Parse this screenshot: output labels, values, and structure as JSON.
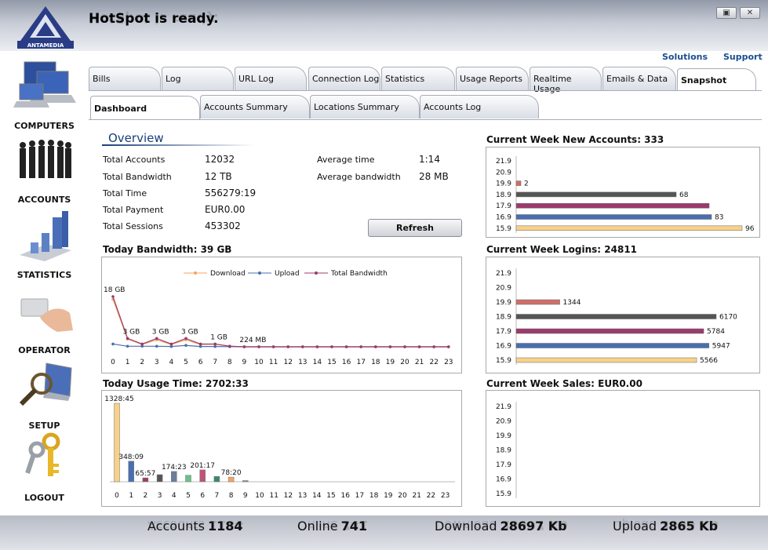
{
  "app": {
    "title": "HotSpot is ready.",
    "logo_text": "ANTAMEDIA"
  },
  "window_buttons": [
    "restore",
    "close"
  ],
  "sidebar": {
    "items": [
      {
        "label": "COMPUTERS",
        "icon": "computers-icon"
      },
      {
        "label": "ACCOUNTS",
        "icon": "accounts-icon"
      },
      {
        "label": "STATISTICS",
        "icon": "statistics-icon"
      },
      {
        "label": "OPERATOR",
        "icon": "operator-icon"
      },
      {
        "label": "SETUP",
        "icon": "setup-icon"
      },
      {
        "label": "LOGOUT",
        "icon": "logout-icon"
      }
    ]
  },
  "links": {
    "solutions": "Solutions",
    "support": "Support"
  },
  "tabs_row1": [
    "Bills",
    "Log",
    "URL Log",
    "Connection Log",
    "Statistics",
    "Usage Reports",
    "Realtime Usage",
    "Emails & Data",
    "Snapshot"
  ],
  "tabs_row2": [
    "Dashboard",
    "Accounts Summary",
    "Locations Summary",
    "Accounts Log"
  ],
  "active_tab1": "Snapshot",
  "active_tab2": "Dashboard",
  "overview": {
    "title": "Overview",
    "stats": [
      {
        "label": "Total Accounts",
        "value": "12032"
      },
      {
        "label": "Total Bandwidth",
        "value": "12 TB"
      },
      {
        "label": "Total Time",
        "value": "556279:19"
      },
      {
        "label": "Total Payment",
        "value": "EUR0.00"
      },
      {
        "label": "Total Sessions",
        "value": "453302"
      }
    ],
    "stats2": [
      {
        "label": "Average time",
        "value": "1:14"
      },
      {
        "label": "Average bandwidth",
        "value": "28 MB"
      }
    ],
    "refresh_label": "Refresh"
  },
  "bottom": {
    "accounts_label": "Accounts",
    "accounts_value": "1184",
    "online_label": "Online",
    "online_value": "741",
    "download_label": "Download",
    "download_value": "28697 Kb",
    "upload_label": "Upload",
    "upload_value": "2865 Kb"
  },
  "chart_data": [
    {
      "type": "line",
      "title": "Today Bandwidth: 39 GB",
      "x": [
        0,
        1,
        2,
        3,
        4,
        5,
        6,
        7,
        8,
        9,
        10,
        11,
        12,
        13,
        14,
        15,
        16,
        17,
        18,
        19,
        20,
        21,
        22,
        23
      ],
      "series": [
        {
          "name": "Download",
          "color": "#f4a460",
          "values": [
            17,
            2.8,
            0.8,
            2.5,
            0.8,
            2.5,
            0.8,
            0.9,
            0.2,
            0,
            0,
            0,
            0,
            0,
            0,
            0,
            0,
            0,
            0,
            0,
            0,
            0,
            0,
            0
          ]
        },
        {
          "name": "Upload",
          "color": "#4a6fb0",
          "values": [
            1,
            0.2,
            0.2,
            0.2,
            0.1,
            0.5,
            0.1,
            0.1,
            0.05,
            0,
            0,
            0,
            0,
            0,
            0,
            0,
            0,
            0,
            0,
            0,
            0,
            0,
            0,
            0
          ]
        },
        {
          "name": "Total Bandwidth",
          "color": "#9b3b6b",
          "values": [
            18,
            3,
            1,
            3,
            1,
            3,
            1,
            1,
            0.224,
            0,
            0,
            0,
            0,
            0,
            0,
            0,
            0,
            0,
            0,
            0,
            0,
            0,
            0,
            0
          ]
        }
      ],
      "labels": [
        {
          "x": 0,
          "text": "18 GB"
        },
        {
          "x": 1,
          "text": "3 GB"
        },
        {
          "x": 3,
          "text": "3 GB"
        },
        {
          "x": 5,
          "text": "3 GB"
        },
        {
          "x": 7,
          "text": "1 GB"
        },
        {
          "x": 9,
          "text": "224 MB"
        }
      ],
      "ylim": [
        0,
        18
      ]
    },
    {
      "type": "bar",
      "title": "Today Usage Time: 2702:33",
      "categories": [
        "0",
        "1",
        "2",
        "3",
        "4",
        "5",
        "6",
        "7",
        "8",
        "9",
        "10",
        "11",
        "12",
        "13",
        "14",
        "15",
        "16",
        "17",
        "18",
        "19",
        "20",
        "21",
        "22",
        "23"
      ],
      "values": [
        1328.75,
        348.15,
        65.95,
        120,
        174.38,
        110,
        201.28,
        90,
        78.33,
        20,
        0,
        0,
        0,
        0,
        0,
        0,
        0,
        0,
        0,
        0,
        0,
        0,
        0,
        0
      ],
      "bar_labels": [
        "1328:45",
        "348:09",
        "65:57",
        "",
        "174:23",
        "",
        "201:17",
        "",
        "78:20",
        "",
        "",
        "",
        "",
        "",
        "",
        "",
        "",
        "",
        "",
        "",
        "",
        "",
        "",
        ""
      ],
      "colors": [
        "#f7d08a",
        "#4a6fb0",
        "#9b3b6b",
        "#555555",
        "#6b7f9b",
        "#6ac08a",
        "#c2527a",
        "#3a8a6a",
        "#f4a460",
        "#888888"
      ],
      "ylim": [
        0,
        1328.75
      ]
    },
    {
      "type": "bar",
      "orientation": "horizontal",
      "title": "Current Week New Accounts: 333",
      "categories": [
        "21.9",
        "20.9",
        "19.9",
        "18.9",
        "17.9",
        "16.9",
        "15.9"
      ],
      "values": [
        0,
        0,
        2,
        68,
        82,
        83,
        96
      ],
      "bar_labels": [
        "",
        "",
        "2",
        "68",
        "",
        "83",
        "96"
      ],
      "colors": [
        "#888888",
        "#888888",
        "#cf6f6a",
        "#555555",
        "#9b3b6b",
        "#4a6fb0",
        "#f7d08a"
      ],
      "xlim": [
        0,
        96
      ]
    },
    {
      "type": "bar",
      "orientation": "horizontal",
      "title": "Current Week Logins: 24811",
      "categories": [
        "21.9",
        "20.9",
        "19.9",
        "18.9",
        "17.9",
        "16.9",
        "15.9"
      ],
      "values": [
        0,
        0,
        1344,
        6170,
        5784,
        5947,
        5566
      ],
      "bar_labels": [
        "",
        "",
        "1344",
        "6170",
        "5784",
        "5947",
        "5566"
      ],
      "colors": [
        "#888888",
        "#888888",
        "#cf6f6a",
        "#555555",
        "#9b3b6b",
        "#4a6fb0",
        "#f7d08a"
      ],
      "xlim": [
        0,
        6170
      ]
    },
    {
      "type": "bar",
      "orientation": "horizontal",
      "title": "Current Week Sales: EUR0.00",
      "categories": [
        "21.9",
        "20.9",
        "19.9",
        "18.9",
        "17.9",
        "16.9",
        "15.9"
      ],
      "values": [
        0,
        0,
        0,
        0,
        0,
        0,
        0
      ],
      "bar_labels": [
        "",
        "",
        "",
        "",
        "",
        "",
        ""
      ],
      "colors": [
        "#888888",
        "#888888",
        "#888888",
        "#888888",
        "#888888",
        "#888888",
        "#888888"
      ],
      "xlim": [
        0,
        1
      ]
    }
  ]
}
